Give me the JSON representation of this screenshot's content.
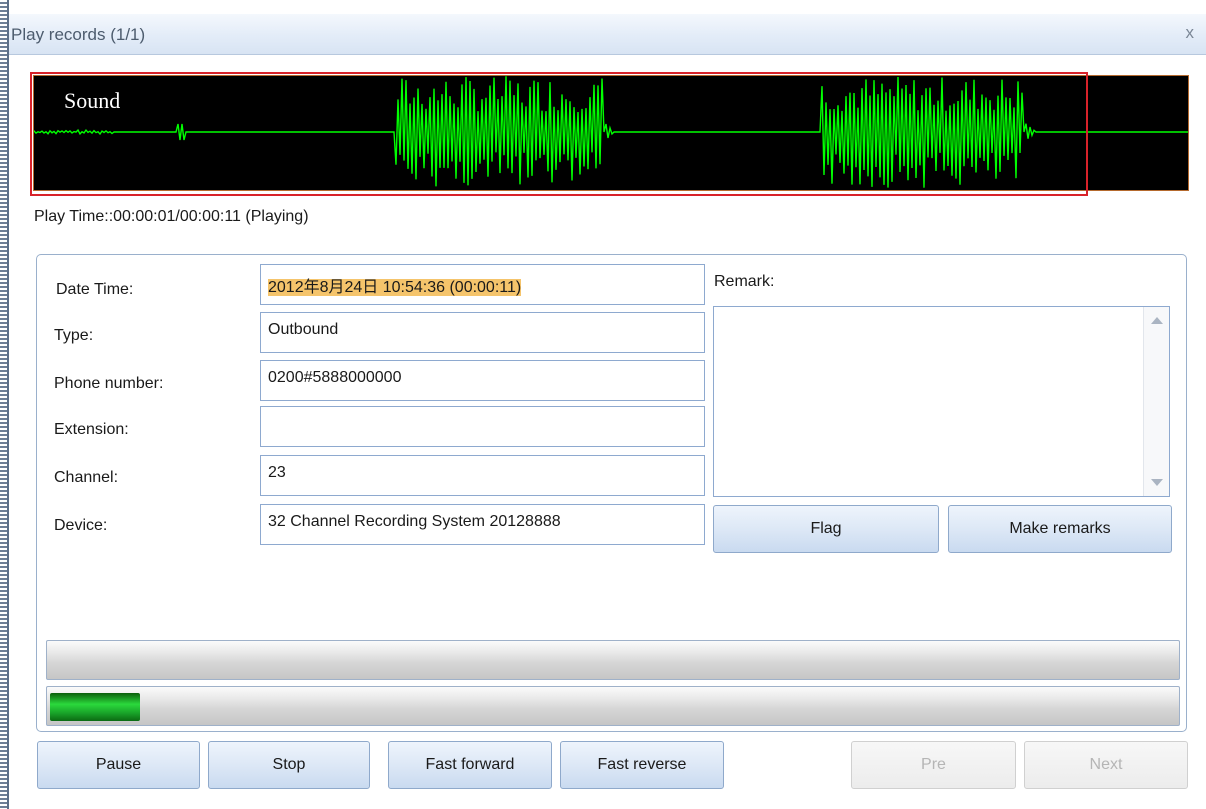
{
  "window": {
    "title": "Play records (1/1)",
    "close_glyph": "x"
  },
  "waveform": {
    "label": "Sound",
    "color": "#00ff00",
    "background": "#000000",
    "highlight_border": "#d8222a"
  },
  "playback": {
    "status_text": "Play Time::00:00:01/00:00:11 (Playing)",
    "progress": 0.08,
    "volume_bar": 0
  },
  "record": {
    "date_time_label": "Date Time:",
    "date_time_value": "2012年8月24日 10:54:36 (00:00:11)",
    "type_label": "Type:",
    "type_value": "Outbound",
    "phone_label": "Phone number:",
    "phone_value": "0200#5888000000",
    "extension_label": "Extension:",
    "extension_value": "",
    "channel_label": "Channel:",
    "channel_value": "23",
    "device_label": "Device:",
    "device_value": "32 Channel Recording System 20128888"
  },
  "remark": {
    "label": "Remark:",
    "text": "",
    "flag_button": "Flag",
    "make_remarks_button": "Make remarks"
  },
  "controls": {
    "pause": "Pause",
    "stop": "Stop",
    "fast_forward": "Fast forward",
    "fast_reverse": "Fast reverse",
    "pre": "Pre",
    "next": "Next"
  },
  "icons": {
    "close": "close-icon",
    "scroll_up": "scroll-up-arrow-icon",
    "scroll_down": "scroll-down-arrow-icon"
  }
}
